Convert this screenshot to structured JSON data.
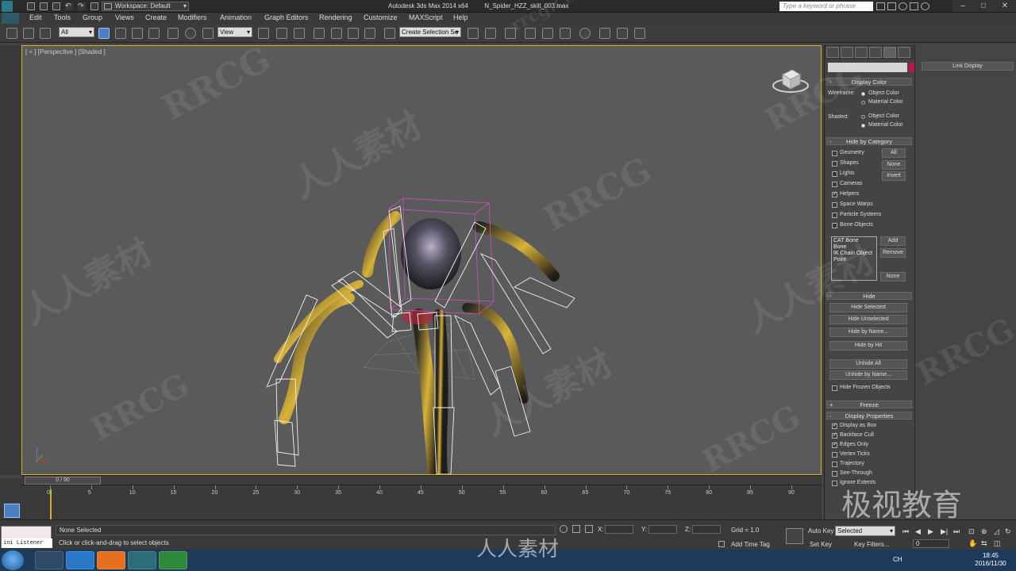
{
  "titlebar": {
    "workspace_label": "Workspace: Default",
    "app_title": "Autodesk 3ds Max  2014 x64",
    "file_name": "N_Spider_HZZ_skill_003.max",
    "search_placeholder": "Type a keyword or phrase"
  },
  "menu": [
    "Edit",
    "Tools",
    "Group",
    "Views",
    "Create",
    "Modifiers",
    "Animation",
    "Graph Editors",
    "Rendering",
    "Customize",
    "MAXScript",
    "Help"
  ],
  "toolbar": {
    "selection_filter": "All",
    "reference_coord": "View",
    "named_selection": "Create Selection Se"
  },
  "viewport": {
    "label": "[ + ] [Perspective ] [Shaded ]"
  },
  "command_panel": {
    "display_color": {
      "title": "Display Color",
      "wireframe_label": "Wireframe:",
      "shaded_label": "Shaded:",
      "object_color": "Object Color",
      "material_color": "Material Color"
    },
    "hide_by_category": {
      "title": "Hide by Category",
      "items": [
        {
          "label": "Geometry",
          "checked": false
        },
        {
          "label": "Shapes",
          "checked": false
        },
        {
          "label": "Lights",
          "checked": false
        },
        {
          "label": "Cameras",
          "checked": false
        },
        {
          "label": "Helpers",
          "checked": true
        },
        {
          "label": "Space Warps",
          "checked": false
        },
        {
          "label": "Particle Systems",
          "checked": false
        },
        {
          "label": "Bone Objects",
          "checked": false
        }
      ],
      "btn_all": "All",
      "btn_none": "None",
      "btn_invert": "Invert",
      "filter_list": [
        "CAT Bone",
        "Bone",
        "IK Chain Object",
        "Point"
      ],
      "btn_add": "Add",
      "btn_remove": "Remove",
      "btn_none2": "None"
    },
    "hide": {
      "title": "Hide",
      "hide_selected": "Hide Selected",
      "hide_unselected": "Hide Unselected",
      "hide_by_name": "Hide by Name...",
      "hide_by_hit": "Hide by Hit",
      "unhide_all": "Unhide All",
      "unhide_by_name": "Unhide by Name...",
      "hide_frozen": "Hide Frozen Objects"
    },
    "freeze_title": "Freeze",
    "display_properties": {
      "title": "Display Properties",
      "items": [
        {
          "label": "Display as Box",
          "checked": true
        },
        {
          "label": "Backface Cull",
          "checked": true
        },
        {
          "label": "Edges Only",
          "checked": true
        },
        {
          "label": "Vertex Ticks",
          "checked": false
        },
        {
          "label": "Trajectory",
          "checked": false
        },
        {
          "label": "See-Through",
          "checked": false
        },
        {
          "label": "Ignore Extents",
          "checked": false
        }
      ]
    }
  },
  "right_panel": {
    "link_display": "Link Display"
  },
  "timeline": {
    "frame_display": "0 / 90",
    "ticks": [
      "0",
      "5",
      "10",
      "15",
      "20",
      "25",
      "30",
      "35",
      "40",
      "45",
      "50",
      "55",
      "60",
      "65",
      "70",
      "75",
      "80",
      "85",
      "90"
    ]
  },
  "status": {
    "maxscript_label": "ini Listener",
    "selection": "None Selected",
    "prompt": "Click or click-and-drag to select objects",
    "x_label": "X:",
    "y_label": "Y:",
    "z_label": "Z:",
    "grid": "Grid = 1.0",
    "add_time_tag": "Add Time Tag",
    "auto_key": "Auto Key",
    "set_key": "Set Key",
    "key_mode": "Selected",
    "key_filters": "Key Filters...",
    "frame_value": "0"
  },
  "taskbar": {
    "time": "18:45",
    "date": "2016/11/30",
    "tray_lang": "CH"
  },
  "watermarks": [
    "RRCG",
    "人人素材",
    "rrcg.cn",
    "极视教育"
  ],
  "colors": {
    "viewport_border": "#d8b22a",
    "swatch": "#c0154a",
    "helper_box": "#d04fbf",
    "selected_blue": "#4b7fc0"
  }
}
